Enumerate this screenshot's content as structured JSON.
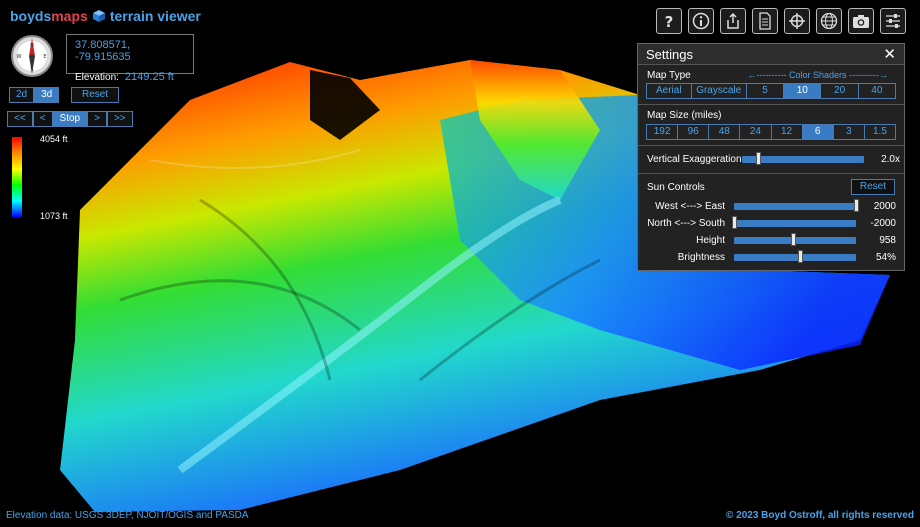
{
  "brand": {
    "part1": "boyds",
    "part2": "maps",
    "part3": "terrain viewer",
    "icon": "cube-icon"
  },
  "colors": {
    "accent": "#4aa3e8",
    "brand_red": "#e8424f",
    "active": "#3a7cc4",
    "panel": "#232323"
  },
  "position": {
    "coords": "37.808571, -79.915635",
    "elevation_label": "Elevation:",
    "elevation_value": "2149.25 ft"
  },
  "view_modes": [
    {
      "label": "2d",
      "active": false
    },
    {
      "label": "3d",
      "active": true
    }
  ],
  "reset_label": "Reset",
  "animation": [
    "<<",
    "<",
    "Stop",
    ">",
    ">>"
  ],
  "elevation_legend": {
    "max": "4054 ft",
    "min": "1073 ft"
  },
  "toolbar": [
    "help-icon",
    "info-icon",
    "share-icon",
    "document-icon",
    "crosshair-icon",
    "globe-icon",
    "camera-icon",
    "settings-sliders-icon"
  ],
  "settings": {
    "title": "Settings",
    "map_type_label": "Map Type",
    "shader_label": "←---------- Color Shaders ----------→",
    "map_types": [
      "Aerial",
      "Grayscale",
      "5",
      "10",
      "20",
      "40"
    ],
    "map_type_active": "10",
    "map_size_label": "Map Size (miles)",
    "map_sizes": [
      "192",
      "96",
      "48",
      "24",
      "12",
      "6",
      "3",
      "1.5"
    ],
    "map_size_active": "6",
    "vertical_exaggeration": {
      "label": "Vertical Exaggeration",
      "value": "2.0x",
      "level": 0.13
    },
    "sun_controls_label": "Sun Controls",
    "sun_reset_label": "Reset",
    "sun": [
      {
        "label": "West <---> East",
        "value": "2000",
        "level": 1.0
      },
      {
        "label": "North <---> South",
        "value": "-2000",
        "level": 0.0
      },
      {
        "label": "Height",
        "value": "958",
        "level": 0.48
      },
      {
        "label": "Brightness",
        "value": "54%",
        "level": 0.54
      }
    ]
  },
  "footer": {
    "left": "Elevation data: USGS 3DEP, NJOIT/OGIS and PASDA",
    "right": "© 2023 Boyd Ostroff, all rights reserved"
  }
}
